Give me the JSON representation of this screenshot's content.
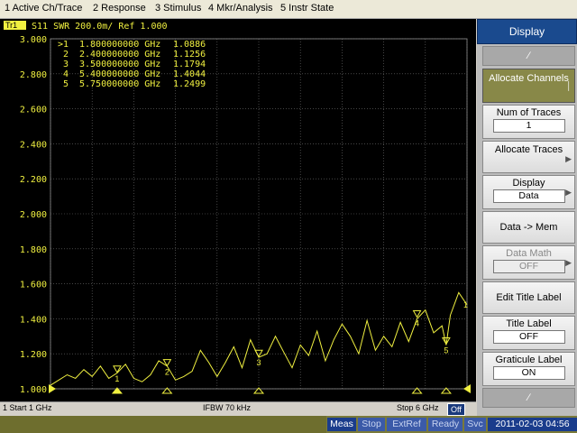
{
  "menu": [
    "1 Active Ch/Trace",
    "2 Response",
    "3 Stimulus",
    "4 Mkr/Analysis",
    "5 Instr State"
  ],
  "trace": {
    "badge": "Tr1",
    "header": "S11  SWR 200.0m/ Ref 1.000",
    "color": "#f0f040"
  },
  "markers": [
    {
      "label": ">1",
      "freq": "1.800000000 GHz",
      "value": "1.0886"
    },
    {
      "label": "2",
      "freq": "2.400000000 GHz",
      "value": "1.1256"
    },
    {
      "label": "3",
      "freq": "3.500000000 GHz",
      "value": "1.1794"
    },
    {
      "label": "4",
      "freq": "5.400000000 GHz",
      "value": "1.4044"
    },
    {
      "label": "5",
      "freq": "5.750000000 GHz",
      "value": "1.2499"
    }
  ],
  "chart_data": {
    "type": "line",
    "x_unit": "GHz",
    "xlim": [
      1,
      6
    ],
    "ylim": [
      1.0,
      3.0
    ],
    "y_ticks": [
      "3.000",
      "2.800",
      "2.600",
      "2.400",
      "2.200",
      "2.000",
      "1.800",
      "1.600",
      "1.400",
      "1.200",
      "1.000"
    ],
    "grid": true,
    "series": [
      {
        "x": [
          1.0,
          1.1,
          1.2,
          1.3,
          1.4,
          1.5,
          1.6,
          1.7,
          1.8,
          1.9,
          2.0,
          2.1,
          2.2,
          2.3,
          2.4,
          2.5,
          2.6,
          2.7,
          2.8,
          2.9,
          3.0,
          3.1,
          3.2,
          3.3,
          3.4,
          3.5,
          3.6,
          3.7,
          3.8,
          3.9,
          4.0,
          4.1,
          4.2,
          4.3,
          4.4,
          4.5,
          4.6,
          4.7,
          4.8,
          4.9,
          5.0,
          5.1,
          5.2,
          5.3,
          5.4,
          5.5,
          5.6,
          5.7,
          5.75,
          5.8,
          5.9,
          6.0
        ],
        "y": [
          1.02,
          1.05,
          1.08,
          1.06,
          1.11,
          1.07,
          1.13,
          1.06,
          1.09,
          1.14,
          1.06,
          1.04,
          1.08,
          1.16,
          1.13,
          1.05,
          1.07,
          1.1,
          1.22,
          1.15,
          1.07,
          1.15,
          1.24,
          1.12,
          1.28,
          1.18,
          1.2,
          1.3,
          1.21,
          1.12,
          1.25,
          1.19,
          1.33,
          1.16,
          1.28,
          1.37,
          1.3,
          1.2,
          1.39,
          1.22,
          1.3,
          1.24,
          1.38,
          1.27,
          1.4,
          1.45,
          1.32,
          1.36,
          1.25,
          1.42,
          1.55,
          1.48
        ]
      }
    ],
    "marker_x": [
      1.8,
      2.4,
      3.5,
      5.4,
      5.75
    ],
    "marker_y": [
      1.0886,
      1.1256,
      1.1794,
      1.4044,
      1.2499
    ]
  },
  "status": {
    "start": "1  Start 1 GHz",
    "ifbw": "IFBW 70 kHz",
    "stop": "Stop 6 GHz",
    "off": "Off"
  },
  "bottom": {
    "meas": "Meas",
    "stop": "Stop",
    "extref": "ExtRef",
    "ready": "Ready",
    "svc": "Svc",
    "datetime": "2011-02-03 04:56"
  },
  "softkeys": {
    "title": "Display",
    "alloc_channels": "Allocate Channels",
    "num_traces_label": "Num of Traces",
    "num_traces_value": "1",
    "alloc_traces": "Allocate Traces",
    "display_label": "Display",
    "display_value": "Data",
    "data_mem": "Data -> Mem",
    "data_math_label": "Data Math",
    "data_math_value": "OFF",
    "edit_title": "Edit Title Label",
    "title_label": "Title Label",
    "title_label_value": "OFF",
    "grat_label": "Graticule Label",
    "grat_label_value": "ON"
  }
}
